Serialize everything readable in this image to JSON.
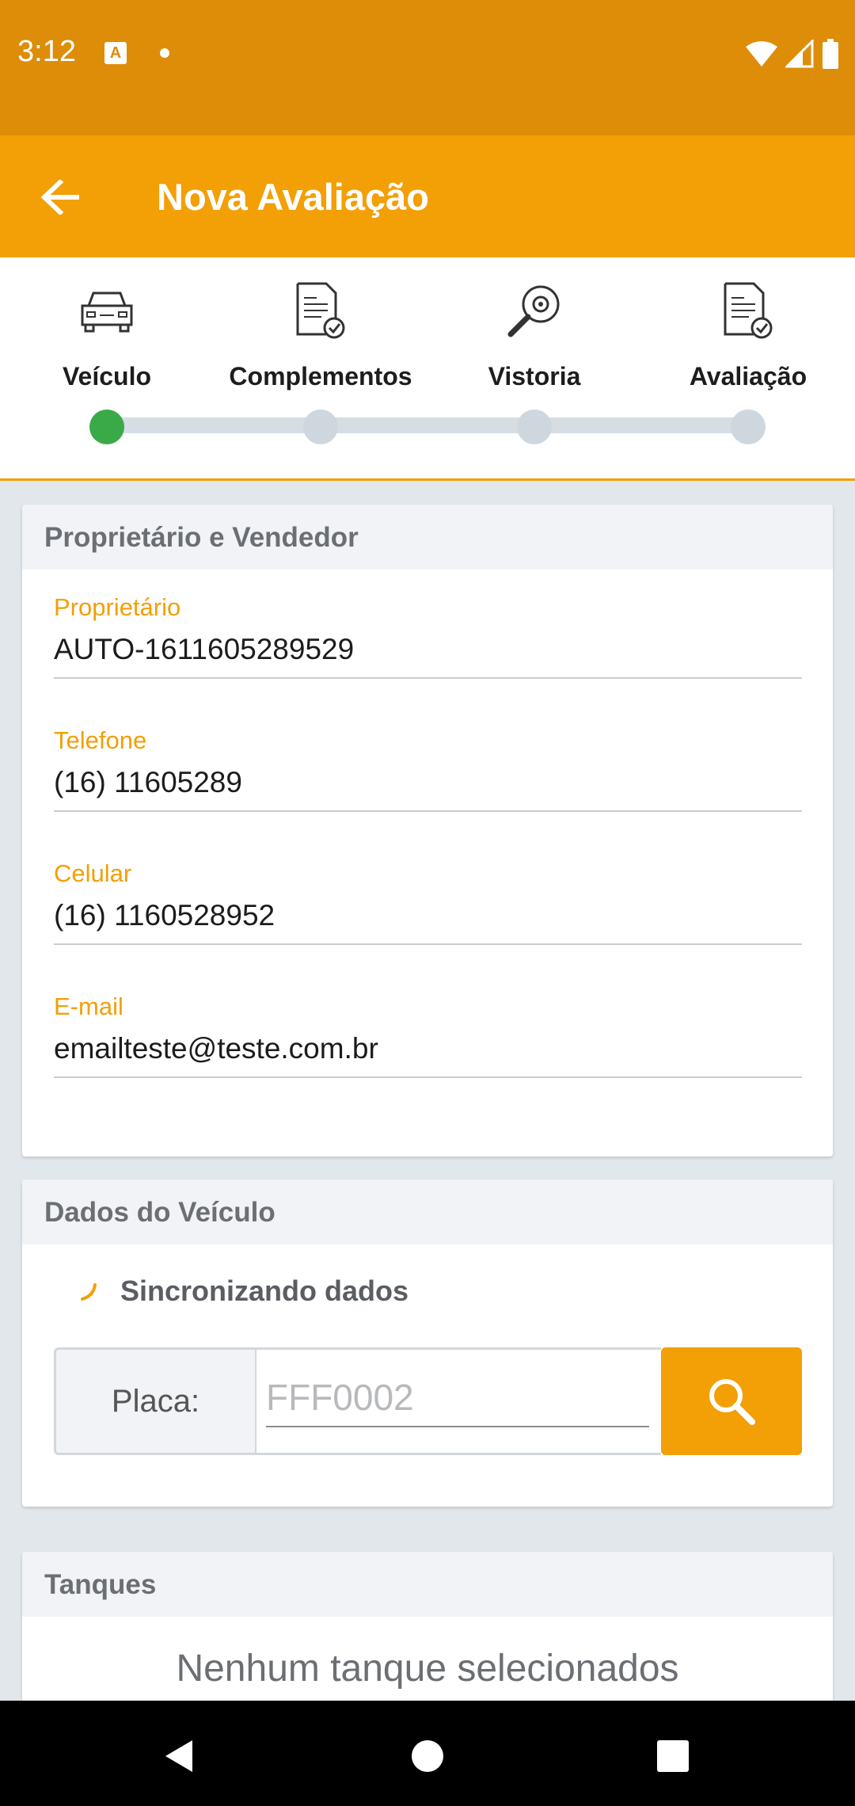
{
  "status_bar": {
    "time": "3:12",
    "notification_letter": "A"
  },
  "app_bar": {
    "title": "Nova Avaliação"
  },
  "stepper": {
    "steps": [
      {
        "label": "Veículo",
        "icon": "car-icon",
        "active": true
      },
      {
        "label": "Complementos",
        "icon": "document-check-icon",
        "active": false
      },
      {
        "label": "Vistoria",
        "icon": "magnifier-icon",
        "active": false
      },
      {
        "label": "Avaliação",
        "icon": "document-check-icon",
        "active": false
      }
    ],
    "colors": {
      "active": "#3aaa48",
      "inactive": "#cfd7de"
    }
  },
  "owner_section": {
    "title": "Proprietário e Vendedor",
    "fields": [
      {
        "label": "Proprietário",
        "value": "AUTO-1611605289529"
      },
      {
        "label": "Telefone",
        "value": "(16) 11605289"
      },
      {
        "label": "Celular",
        "value": "(16) 1160528952"
      },
      {
        "label": "E-mail",
        "value": "emailteste@teste.com.br"
      }
    ]
  },
  "vehicle_section": {
    "title": "Dados do Veículo",
    "sync_text": "Sincronizando dados",
    "plate_label": "Placa:",
    "plate_placeholder": "FFF0002"
  },
  "tanks_section": {
    "title": "Tanques",
    "empty_text": "Nenhum tanque selecionados"
  },
  "theme": {
    "primary": "#f39f06",
    "status_bar": "#de8d08",
    "label": "#f39f06"
  }
}
